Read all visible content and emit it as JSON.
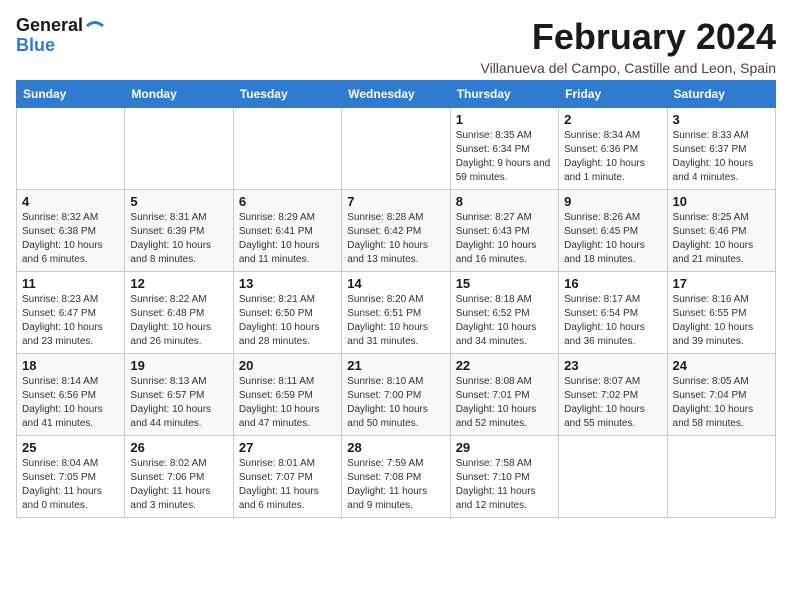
{
  "logo": {
    "line1": "General",
    "line2": "Blue"
  },
  "title": "February 2024",
  "subtitle": "Villanueva del Campo, Castille and Leon, Spain",
  "days_of_week": [
    "Sunday",
    "Monday",
    "Tuesday",
    "Wednesday",
    "Thursday",
    "Friday",
    "Saturday"
  ],
  "weeks": [
    [
      {
        "day": "",
        "info": ""
      },
      {
        "day": "",
        "info": ""
      },
      {
        "day": "",
        "info": ""
      },
      {
        "day": "",
        "info": ""
      },
      {
        "day": "1",
        "info": "Sunrise: 8:35 AM\nSunset: 6:34 PM\nDaylight: 9 hours and 59 minutes."
      },
      {
        "day": "2",
        "info": "Sunrise: 8:34 AM\nSunset: 6:36 PM\nDaylight: 10 hours and 1 minute."
      },
      {
        "day": "3",
        "info": "Sunrise: 8:33 AM\nSunset: 6:37 PM\nDaylight: 10 hours and 4 minutes."
      }
    ],
    [
      {
        "day": "4",
        "info": "Sunrise: 8:32 AM\nSunset: 6:38 PM\nDaylight: 10 hours and 6 minutes."
      },
      {
        "day": "5",
        "info": "Sunrise: 8:31 AM\nSunset: 6:39 PM\nDaylight: 10 hours and 8 minutes."
      },
      {
        "day": "6",
        "info": "Sunrise: 8:29 AM\nSunset: 6:41 PM\nDaylight: 10 hours and 11 minutes."
      },
      {
        "day": "7",
        "info": "Sunrise: 8:28 AM\nSunset: 6:42 PM\nDaylight: 10 hours and 13 minutes."
      },
      {
        "day": "8",
        "info": "Sunrise: 8:27 AM\nSunset: 6:43 PM\nDaylight: 10 hours and 16 minutes."
      },
      {
        "day": "9",
        "info": "Sunrise: 8:26 AM\nSunset: 6:45 PM\nDaylight: 10 hours and 18 minutes."
      },
      {
        "day": "10",
        "info": "Sunrise: 8:25 AM\nSunset: 6:46 PM\nDaylight: 10 hours and 21 minutes."
      }
    ],
    [
      {
        "day": "11",
        "info": "Sunrise: 8:23 AM\nSunset: 6:47 PM\nDaylight: 10 hours and 23 minutes."
      },
      {
        "day": "12",
        "info": "Sunrise: 8:22 AM\nSunset: 6:48 PM\nDaylight: 10 hours and 26 minutes."
      },
      {
        "day": "13",
        "info": "Sunrise: 8:21 AM\nSunset: 6:50 PM\nDaylight: 10 hours and 28 minutes."
      },
      {
        "day": "14",
        "info": "Sunrise: 8:20 AM\nSunset: 6:51 PM\nDaylight: 10 hours and 31 minutes."
      },
      {
        "day": "15",
        "info": "Sunrise: 8:18 AM\nSunset: 6:52 PM\nDaylight: 10 hours and 34 minutes."
      },
      {
        "day": "16",
        "info": "Sunrise: 8:17 AM\nSunset: 6:54 PM\nDaylight: 10 hours and 36 minutes."
      },
      {
        "day": "17",
        "info": "Sunrise: 8:16 AM\nSunset: 6:55 PM\nDaylight: 10 hours and 39 minutes."
      }
    ],
    [
      {
        "day": "18",
        "info": "Sunrise: 8:14 AM\nSunset: 6:56 PM\nDaylight: 10 hours and 41 minutes."
      },
      {
        "day": "19",
        "info": "Sunrise: 8:13 AM\nSunset: 6:57 PM\nDaylight: 10 hours and 44 minutes."
      },
      {
        "day": "20",
        "info": "Sunrise: 8:11 AM\nSunset: 6:59 PM\nDaylight: 10 hours and 47 minutes."
      },
      {
        "day": "21",
        "info": "Sunrise: 8:10 AM\nSunset: 7:00 PM\nDaylight: 10 hours and 50 minutes."
      },
      {
        "day": "22",
        "info": "Sunrise: 8:08 AM\nSunset: 7:01 PM\nDaylight: 10 hours and 52 minutes."
      },
      {
        "day": "23",
        "info": "Sunrise: 8:07 AM\nSunset: 7:02 PM\nDaylight: 10 hours and 55 minutes."
      },
      {
        "day": "24",
        "info": "Sunrise: 8:05 AM\nSunset: 7:04 PM\nDaylight: 10 hours and 58 minutes."
      }
    ],
    [
      {
        "day": "25",
        "info": "Sunrise: 8:04 AM\nSunset: 7:05 PM\nDaylight: 11 hours and 0 minutes."
      },
      {
        "day": "26",
        "info": "Sunrise: 8:02 AM\nSunset: 7:06 PM\nDaylight: 11 hours and 3 minutes."
      },
      {
        "day": "27",
        "info": "Sunrise: 8:01 AM\nSunset: 7:07 PM\nDaylight: 11 hours and 6 minutes."
      },
      {
        "day": "28",
        "info": "Sunrise: 7:59 AM\nSunset: 7:08 PM\nDaylight: 11 hours and 9 minutes."
      },
      {
        "day": "29",
        "info": "Sunrise: 7:58 AM\nSunset: 7:10 PM\nDaylight: 11 hours and 12 minutes."
      },
      {
        "day": "",
        "info": ""
      },
      {
        "day": "",
        "info": ""
      }
    ]
  ]
}
